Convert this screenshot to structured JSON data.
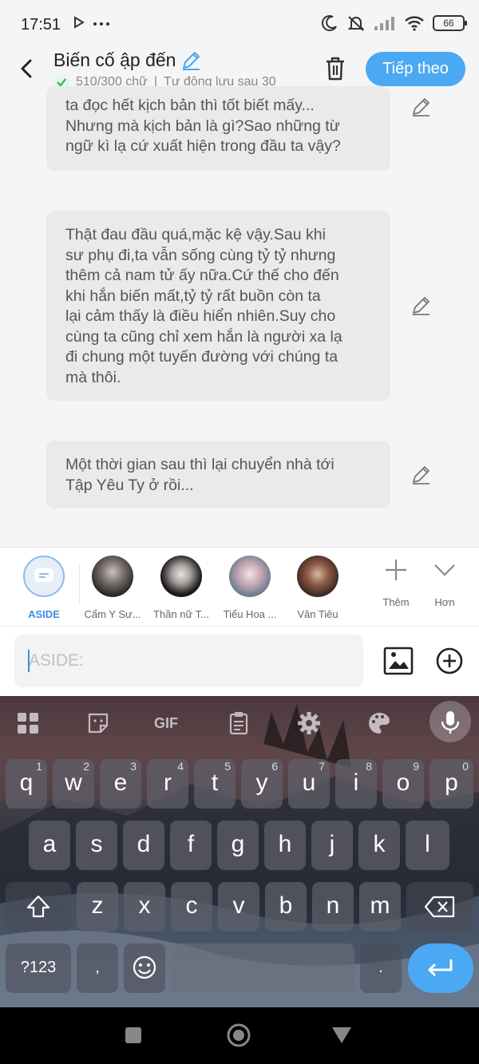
{
  "status_bar": {
    "time": "17:51",
    "battery": "66"
  },
  "header": {
    "title": "Biến cố ập đến",
    "word_count": "510/300 chữ",
    "autosave": "Tự động lưu sau 30",
    "next_label": "Tiếp theo"
  },
  "messages": [
    {
      "text": "ta đọc hết kịch bản thì tốt biết mấy...\nNhưng mà kịch bản là gì?Sao những từ\nngữ kì lạ cứ xuất hiện trong đầu ta vậy?"
    },
    {
      "text": " Thật đau đầu quá,mặc kệ vậy.Sau khi\nsư phụ đi,ta vẫn sống cùng tỷ tỷ nhưng\nthêm cả nam tử ấy nữa.Cứ thế cho đến\nkhi hắn biến mất,tỷ tỷ rất buồn còn ta\nlại cảm thấy là điều hiển nhiên.Suy cho\ncùng ta cũng chỉ xem hắn là người xa lạ\nđi chung một tuyến đường với chúng ta\nmà thôi."
    },
    {
      "text": "Một thời gian sau thì lại chuyển nhà tới\nTập Yêu Ty ở rồi..."
    }
  ],
  "characters": [
    {
      "name": "ASIDE"
    },
    {
      "name": "Cẩm Y Sư..."
    },
    {
      "name": "Thần nữ T..."
    },
    {
      "name": "Tiểu Hoa ..."
    },
    {
      "name": "Văn Tiêu"
    }
  ],
  "tools": {
    "add_label": "Thêm",
    "more_label": "Hơn"
  },
  "input": {
    "placeholder": "ASIDE:"
  },
  "keyboard": {
    "toolbar": [
      "apps-icon",
      "sticker-icon",
      "gif-icon",
      "clipboard-icon",
      "settings-icon",
      "theme-icon",
      "mic-icon"
    ],
    "gif_label": "GIF",
    "row1": [
      [
        "q",
        "1"
      ],
      [
        "w",
        "2"
      ],
      [
        "e",
        "3"
      ],
      [
        "r",
        "4"
      ],
      [
        "t",
        "5"
      ],
      [
        "y",
        "6"
      ],
      [
        "u",
        "7"
      ],
      [
        "i",
        "8"
      ],
      [
        "o",
        "9"
      ],
      [
        "p",
        "0"
      ]
    ],
    "row2": [
      "a",
      "s",
      "d",
      "f",
      "g",
      "h",
      "j",
      "k",
      "l"
    ],
    "row3": [
      "z",
      "x",
      "c",
      "v",
      "b",
      "n",
      "m"
    ],
    "numbers_label": "?123",
    "comma_label": ",",
    "period_label": "."
  },
  "colors": {
    "accent": "#4ba8f2",
    "check": "#2fb34a"
  }
}
